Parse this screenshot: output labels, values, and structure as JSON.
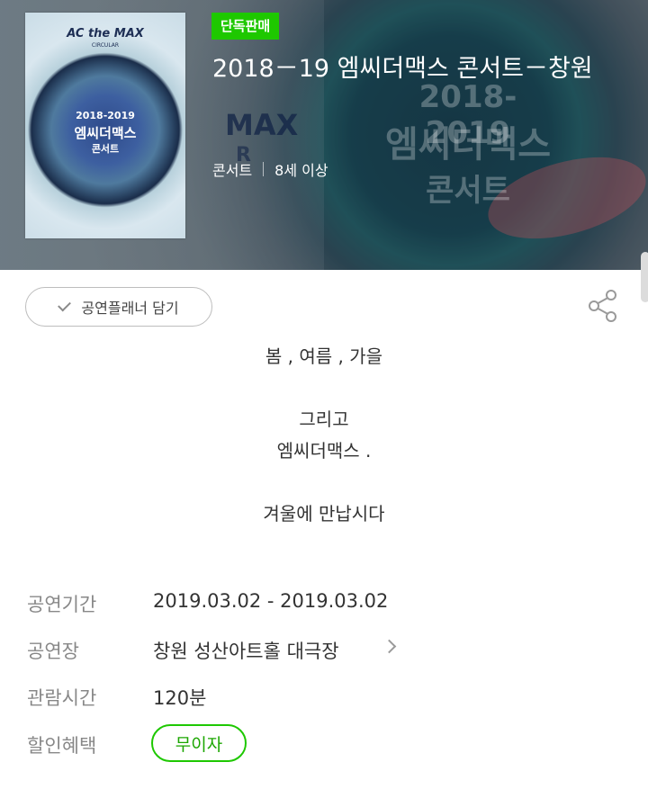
{
  "poster": {
    "brand": "AC the MAX",
    "sub": "CIRCULAR",
    "line1": "2018-2019",
    "line2": "엠씨더맥스",
    "line3": "콘서트"
  },
  "background": {
    "line1": "2018-2019",
    "line2": "엠씨더맥스",
    "line3": "콘서트",
    "max": "MAX",
    "r": "R"
  },
  "header": {
    "badge": "단독판매",
    "title": "2018－19 엠씨더맥스 콘서트－창원",
    "genre": "콘서트",
    "age": "8세 이상"
  },
  "toolbar": {
    "planner_label": "공연플래너 담기",
    "share_icon": "share-icon"
  },
  "description": {
    "line1": "봄 , 여름 , 가을",
    "line2": "그리고",
    "line3": "엠씨더맥스 .",
    "line4": "겨울에 만납시다"
  },
  "info": {
    "period_label": "공연기간",
    "period_value": "2019.03.02 - 2019.03.02",
    "venue_label": "공연장",
    "venue_value": "창원 성산아트홀 대극장",
    "runtime_label": "관람시간",
    "runtime_value": "120분",
    "discount_label": "할인혜택",
    "discount_value": "무이자"
  },
  "colors": {
    "accent": "#1ec800",
    "label": "#888888",
    "text": "#333333"
  }
}
